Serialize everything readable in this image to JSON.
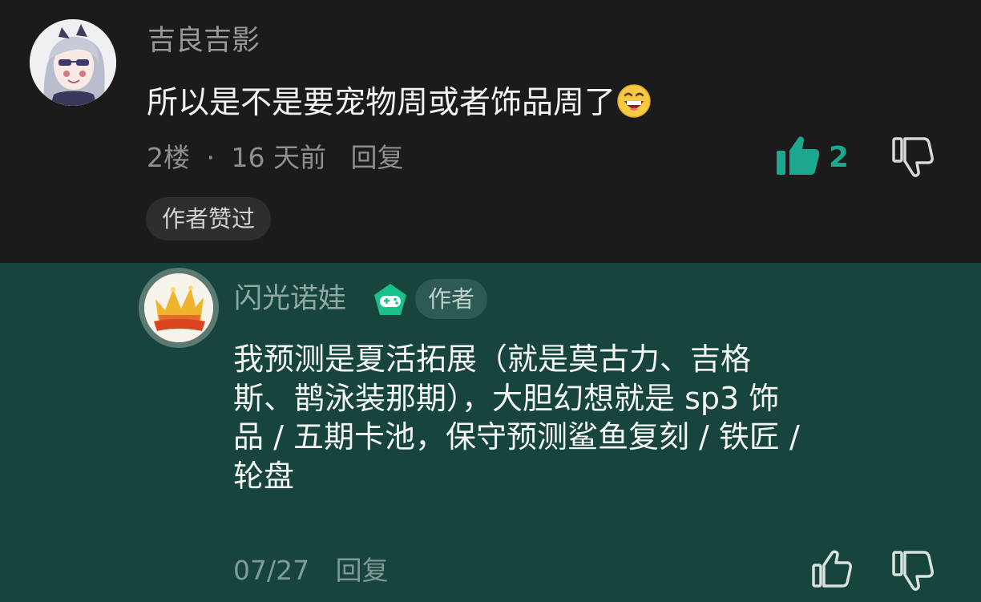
{
  "comment": {
    "username": "吉良吉影",
    "text": "所以是不是要宠物周或者饰品周了",
    "emoji": "grinning-face-emoji",
    "floor": "2楼",
    "separator": "·",
    "time": "16 天前",
    "reply_label": "回复",
    "like_count": "2",
    "liked": true,
    "author_liked_badge": "作者赞过",
    "accent_color": "#1ba88f"
  },
  "reply": {
    "username": "闪光诺娃",
    "author_tag": "作者",
    "lines": [
      "我预测是夏活拓展（就是莫古力、吉格",
      "斯、鹊泳装那期），大胆幻想就是 sp3 饰",
      "品 / 五期卡池，保守预测鲨鱼复刻 / 铁匠 /",
      "轮盘"
    ],
    "date": "07/27",
    "reply_label": "回复",
    "background_color": "#17443c"
  }
}
